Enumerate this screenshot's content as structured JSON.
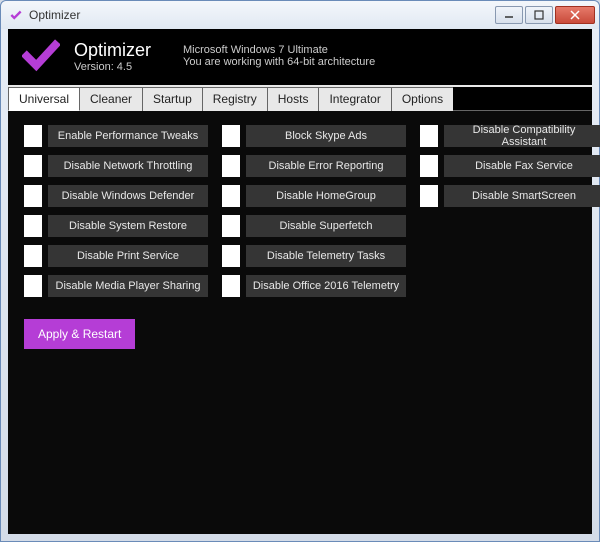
{
  "titlebar": {
    "text": "Optimizer"
  },
  "header": {
    "app_name": "Optimizer",
    "version_label": "Version: 4.5",
    "os_line": "Microsoft Windows 7 Ultimate",
    "arch_line": "You are working with 64-bit architecture"
  },
  "tabs": {
    "t0": "Universal",
    "t1": "Cleaner",
    "t2": "Startup",
    "t3": "Registry",
    "t4": "Hosts",
    "t5": "Integrator",
    "t6": "Options"
  },
  "options": {
    "c1": {
      "r0": "Enable Performance Tweaks",
      "r1": "Disable Network Throttling",
      "r2": "Disable Windows Defender",
      "r3": "Disable System Restore",
      "r4": "Disable Print Service",
      "r5": "Disable Media Player Sharing"
    },
    "c2": {
      "r0": "Block Skype Ads",
      "r1": "Disable Error Reporting",
      "r2": "Disable HomeGroup",
      "r3": "Disable Superfetch",
      "r4": "Disable Telemetry Tasks",
      "r5": "Disable Office 2016 Telemetry"
    },
    "c3": {
      "r0": "Disable Compatibility Assistant",
      "r1": "Disable Fax Service",
      "r2": "Disable SmartScreen"
    }
  },
  "actions": {
    "apply": "Apply & Restart"
  },
  "colors": {
    "accent": "#b53dd6"
  }
}
